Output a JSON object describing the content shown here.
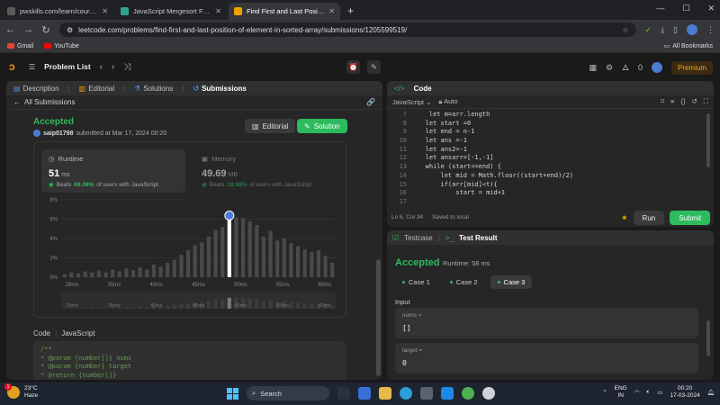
{
  "browser": {
    "tabs": [
      {
        "title": "pwskills.com/learn/course/full-s",
        "color": "#5a5a5a"
      },
      {
        "title": "JavaScript Mergesort Function",
        "color": "#2ea58a"
      },
      {
        "title": "Find First and Last Position of E",
        "color": "#f0a000"
      }
    ],
    "url": "leetcode.com/problems/find-first-and-last-position-of-element-in-sorted-array/submissions/1205599519/",
    "bookmarks": [
      {
        "label": "Gmail",
        "color": "#ea4335"
      },
      {
        "label": "YouTube",
        "color": "#ff0000"
      }
    ],
    "all_bookmarks": "All Bookmarks"
  },
  "lc_nav": {
    "problem_list": "Problem List",
    "fire_count": "0",
    "premium": "Premium"
  },
  "left": {
    "tabs": [
      "Description",
      "Editorial",
      "Solutions",
      "Submissions"
    ],
    "back_label": "All Submissions",
    "status": "Accepted",
    "user": "saip01798",
    "submitted_text": "submitted at Mar 17, 2024 00:20",
    "editorial_btn": "Editorial",
    "solution_btn": "Solution",
    "runtime": {
      "title": "Runtime",
      "value": "51",
      "unit": "ms",
      "beats_prefix": "Beats",
      "beats_pct": "69.08%",
      "beats_suffix": "of users with JavaScript"
    },
    "memory": {
      "title": "Memory",
      "value": "49.69",
      "unit": "MB",
      "beats_prefix": "Beats",
      "beats_pct": "18.98%",
      "beats_suffix": "of users with JavaScript"
    },
    "code_lang_label": "Code",
    "code_lang": "JavaScript",
    "code_lines": [
      "/**",
      " * @param {number[]} nums",
      " * @param {number} target",
      " * @return {number[]}"
    ]
  },
  "chart_data": {
    "type": "bar",
    "ylabel": "",
    "xlabel": "",
    "ytick_labels": [
      "8%",
      "6%",
      "4%",
      "2%",
      "0%"
    ],
    "ylim": [
      0,
      8
    ],
    "xtick_labels": [
      "29ms",
      "35ms",
      "40ms",
      "45ms",
      "50ms",
      "55ms",
      "60ms"
    ],
    "selected_label": "51ms",
    "values": [
      0.3,
      0.5,
      0.4,
      0.6,
      0.5,
      0.7,
      0.5,
      0.8,
      0.6,
      0.9,
      0.7,
      1.0,
      0.8,
      1.3,
      1.1,
      1.5,
      1.8,
      2.3,
      2.8,
      3.3,
      3.6,
      4.2,
      4.9,
      5.2,
      6.0,
      6.2,
      6.1,
      5.8,
      5.4,
      4.2,
      4.8,
      3.8,
      4.0,
      3.5,
      3.2,
      2.9,
      2.6,
      2.8,
      2.2,
      1.5
    ],
    "highlight_index": 24,
    "colors": {
      "bar": "#4a4a4a",
      "highlight": "#ffffff",
      "grid": "#3a3a3a"
    }
  },
  "code_panel": {
    "title": "Code",
    "lang": "JavaScript",
    "mode": "Auto",
    "lines": [
      {
        "n": "7",
        "t": "    let m=arr.length"
      },
      {
        "n": "8",
        "t": "   let start =0"
      },
      {
        "n": "9",
        "t": "   let end = n-1"
      },
      {
        "n": "10",
        "t": "   let ans =-1"
      },
      {
        "n": "11",
        "t": "   let ans2=-1"
      },
      {
        "n": "12",
        "t": "   let ansarr=[-1,-1]"
      },
      {
        "n": "13",
        "t": "   while (start<=end) {"
      },
      {
        "n": "14",
        "t": "       let mid = Math.floor((start+end)/2)"
      },
      {
        "n": "15",
        "t": "       if(arr[mid]<t){"
      },
      {
        "n": "16",
        "t": "           start = mid+1"
      },
      {
        "n": "17",
        "t": ""
      }
    ],
    "cursor": "Ln 6, Col 34",
    "saved": "Saved to local",
    "run": "Run",
    "submit": "Submit"
  },
  "test_panel": {
    "tab_testcase": "Testcase",
    "tab_result": "Test Result",
    "status": "Accepted",
    "runtime": "Runtime: 58 ms",
    "cases": [
      "Case 1",
      "Case 2",
      "Case 3"
    ],
    "input_label": "Input",
    "inputs": [
      {
        "key": "nums =",
        "value": "[]"
      },
      {
        "key": "target =",
        "value": "0"
      }
    ]
  },
  "taskbar": {
    "temp": "23°C",
    "weather": "Haze",
    "search": "Search",
    "lang1": "ENG",
    "lang2": "IN",
    "time": "00:20",
    "date": "17-03-2024",
    "badge": "1"
  }
}
